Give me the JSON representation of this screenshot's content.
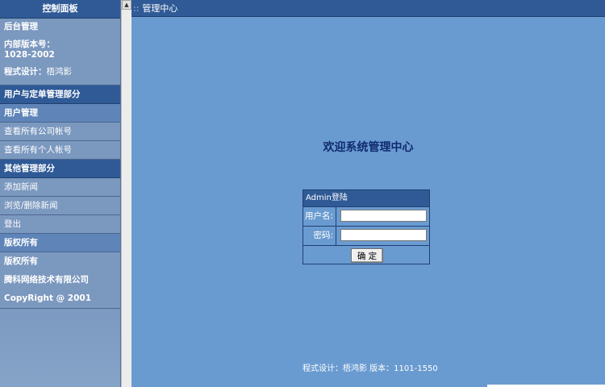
{
  "sidebar": {
    "title": "控制面板",
    "admin_block": {
      "heading": "后台管理",
      "version_label": "内部版本号：",
      "version_value": "1028-2002",
      "design_label": "程式设计：",
      "design_name": "梧鸿影"
    },
    "section_user": "用户与定单管理部分",
    "user_mgmt": "用户管理",
    "view_company_accounts": "查看所有公司帐号",
    "view_personal_accounts": "查看所有个人帐号",
    "section_other": "其他管理部分",
    "add_news": "添加新闻",
    "browse_delete_news": "浏览/删除新闻",
    "logout": "登出",
    "copyright_header": "版权所有",
    "copyright_label": "版权所有",
    "company": "腾科网络技术有限公司",
    "copyright_year": "CopyRight @ 2001"
  },
  "topbar": {
    "dots": "::",
    "title": "管理中心"
  },
  "main": {
    "welcome": "欢迎系统管理中心",
    "login": {
      "header": "Admin登陆",
      "username_label": "用户名:",
      "username_value": "",
      "password_label": "密码:",
      "password_value": "",
      "submit_label": "确 定"
    },
    "footer": "程式设计：梧鸿影 版本：1101-1550"
  }
}
